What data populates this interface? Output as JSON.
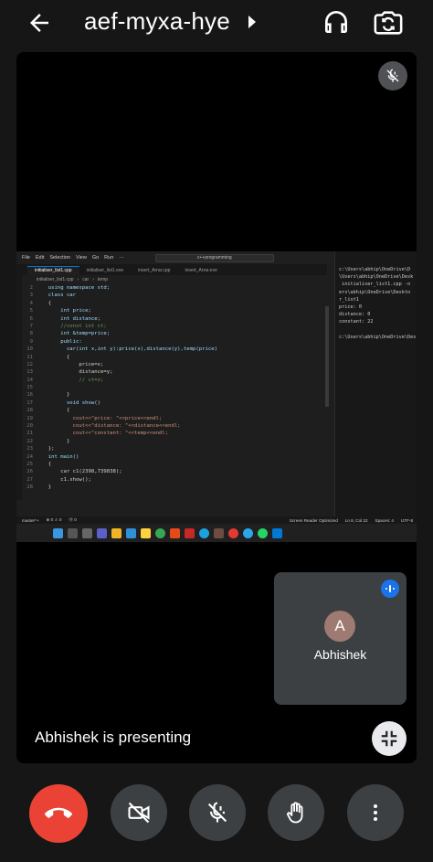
{
  "header": {
    "meeting_code": "aef-myxa-hye",
    "icons": [
      "arrow-left-icon",
      "caret-right-icon",
      "headphones-icon",
      "switch-camera-icon"
    ]
  },
  "shared_screen": {
    "menu": [
      "File",
      "Edit",
      "Selection",
      "View",
      "Go",
      "Run",
      "···"
    ],
    "search_text": "c++programming",
    "tabs": [
      "initialiser_list1.cpp",
      "initialiser_list1.exe",
      "insert_Arrar.cpp",
      "insert_Arrar.exe"
    ],
    "breadcrumb": [
      "initialiser_list1.cpp",
      "car",
      "temp"
    ],
    "code_lines": [
      {
        "n": "2",
        "text": "  using namespace std;"
      },
      {
        "n": "3",
        "text": "  class car"
      },
      {
        "n": "4",
        "text": "  {"
      },
      {
        "n": "5",
        "text": "      int price;"
      },
      {
        "n": "6",
        "text": "      int distance;"
      },
      {
        "n": "7",
        "text": "      //const int ct;"
      },
      {
        "n": "8",
        "text": "      int &temp=price;"
      },
      {
        "n": "9",
        "text": "      public:"
      },
      {
        "n": "10",
        "text": "        car(int x,int y):price(x),distance(y),temp(price)"
      },
      {
        "n": "11",
        "text": "        {"
      },
      {
        "n": "12",
        "text": "            price=x;"
      },
      {
        "n": "13",
        "text": "            distance=y;"
      },
      {
        "n": "14",
        "text": "            // ct=z;"
      },
      {
        "n": "15",
        "text": ""
      },
      {
        "n": "16",
        "text": "        }"
      },
      {
        "n": "17",
        "text": "        void show()"
      },
      {
        "n": "18",
        "text": "        {"
      },
      {
        "n": "19",
        "text": "          cout<<\"price: \"<<price<<endl;"
      },
      {
        "n": "20",
        "text": "          cout<<\"distance: \"<<distance<<endl;"
      },
      {
        "n": "21",
        "text": "          cout<<\"constant: \"<<temp<<endl;"
      },
      {
        "n": "22",
        "text": "        }"
      },
      {
        "n": "23",
        "text": "  };"
      },
      {
        "n": "24",
        "text": "  int main()"
      },
      {
        "n": "25",
        "text": "  {"
      },
      {
        "n": "26",
        "text": "      car c1(2398,739838);"
      },
      {
        "n": "27",
        "text": "      c1.show();"
      },
      {
        "n": "28",
        "text": "  }"
      }
    ],
    "terminal_lines": [
      "c:\\Users\\abhip\\OneDrive\\D",
      "\\Users\\abhip\\OneDrive\\Desk",
      " initialiser_list1.cpp -o",
      "ers\\abhip\\OneDrive\\Deskto",
      "r_list1",
      "price: 0",
      "distance: 0",
      "constant: 22",
      "",
      "c:\\Users\\abhip\\OneDrive\\Des"
    ],
    "status_left": [
      "master*+",
      "⊗ 0 ⚠ 0",
      "Ⓞ 0"
    ],
    "status_right": [
      "Screen Reader Optimized",
      "Ln 8, Col 22",
      "Spaces: 4",
      "UTF-8"
    ]
  },
  "self_tile": {
    "avatar_initial": "A",
    "name": "Abhishek"
  },
  "presenting_text": "Abhishek is presenting",
  "controls": {
    "icons": [
      "end-call-icon",
      "camera-off-icon",
      "mic-off-icon",
      "raise-hand-icon",
      "more-options-icon"
    ]
  },
  "colors": {
    "end_call": "#ea4335",
    "control_bg": "#3c4043",
    "speaking_badge": "#1a73e8",
    "avatar_bg": "#9e7a72"
  }
}
